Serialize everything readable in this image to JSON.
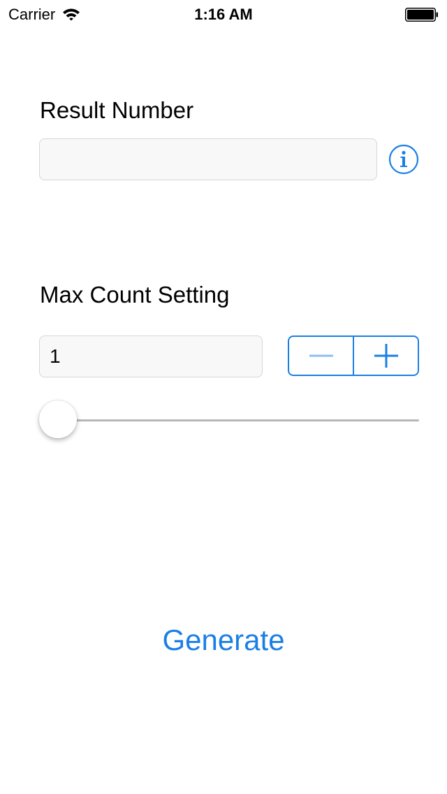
{
  "status_bar": {
    "carrier": "Carrier",
    "time": "1:16 AM",
    "wifi_icon": "wifi-icon",
    "battery_icon": "battery-icon"
  },
  "result_section": {
    "label": "Result Number",
    "value": "",
    "info_icon": "info-icon"
  },
  "max_count_section": {
    "label": "Max Count Setting",
    "value": "1",
    "stepper": {
      "minus_icon": "minus-icon",
      "plus_icon": "plus-icon",
      "minus_enabled": false,
      "plus_enabled": true
    },
    "slider_fraction": 0
  },
  "generate_button": {
    "label": "Generate"
  },
  "colors": {
    "accent": "#1a7fe5",
    "disabled_accent": "#8dbff2",
    "field_background": "#f8f8f8",
    "slider_track": "#b7b7b7"
  }
}
